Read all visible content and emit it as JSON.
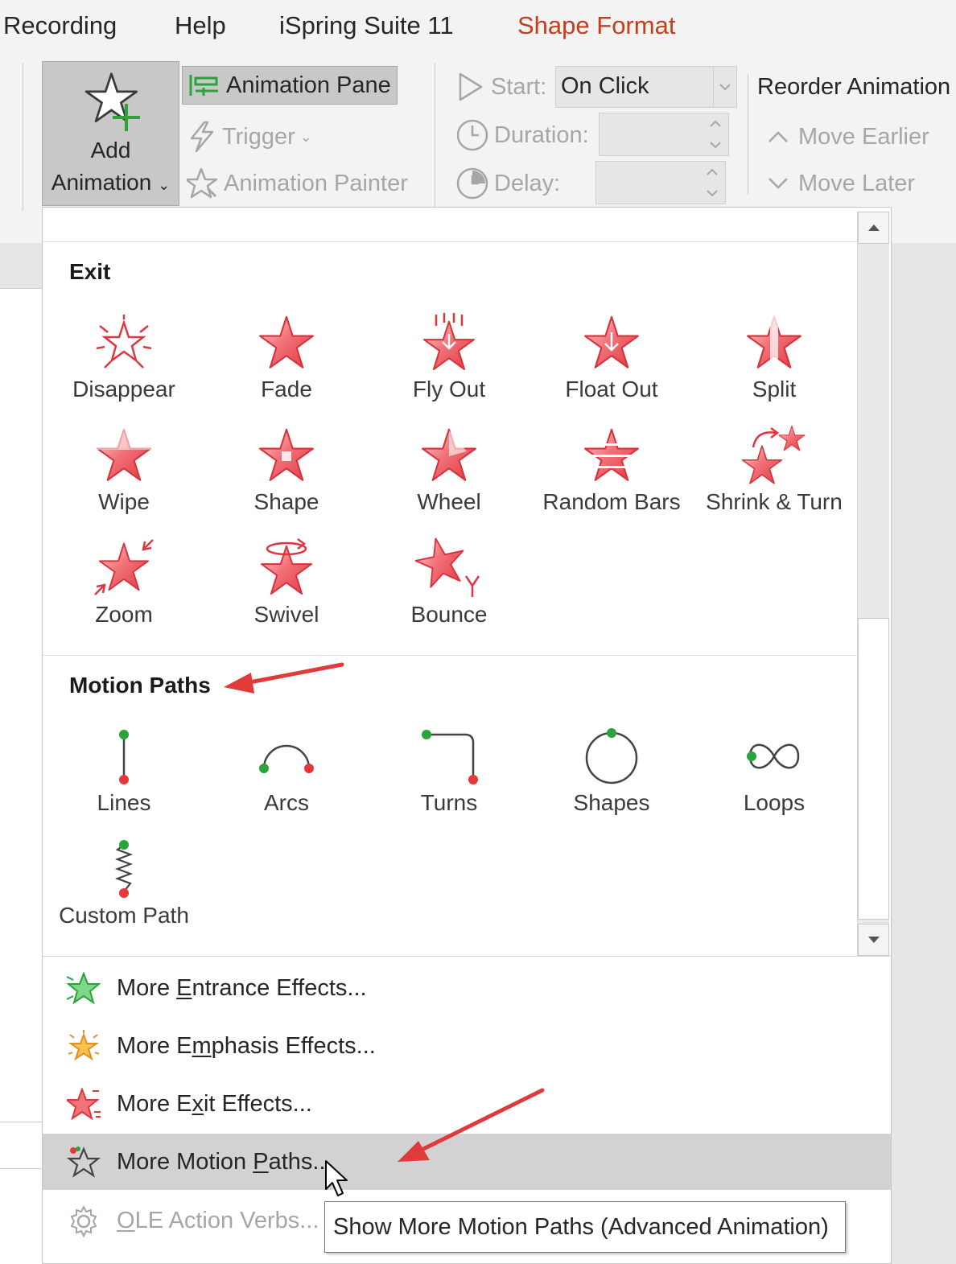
{
  "tabs": [
    "Recording",
    "Help",
    "iSpring Suite 11",
    "Shape Format"
  ],
  "ribbon": {
    "add_animation": {
      "line1": "Add",
      "line2": "Animation"
    },
    "animation_pane": "Animation Pane",
    "trigger": "Trigger",
    "animation_painter": "Animation Painter",
    "start_label": "Start:",
    "start_value": "On Click",
    "duration_label": "Duration:",
    "delay_label": "Delay:",
    "reorder_title": "Reorder Animation",
    "move_earlier": "Move Earlier",
    "move_later": "Move Later"
  },
  "gallery": {
    "exit": {
      "title": "Exit",
      "items": [
        "Disappear",
        "Fade",
        "Fly Out",
        "Float Out",
        "Split",
        "Wipe",
        "Shape",
        "Wheel",
        "Random Bars",
        "Shrink & Turn",
        "Zoom",
        "Swivel",
        "Bounce"
      ]
    },
    "motion": {
      "title": "Motion Paths",
      "items": [
        "Lines",
        "Arcs",
        "Turns",
        "Shapes",
        "Loops",
        "Custom Path"
      ]
    }
  },
  "menu": {
    "entrance": {
      "pre": "More ",
      "key": "E",
      "post": "ntrance Effects..."
    },
    "emphasis": {
      "pre": "More E",
      "key": "m",
      "post": "phasis Effects..."
    },
    "exit": {
      "pre": "More E",
      "key": "x",
      "post": "it Effects..."
    },
    "motion": {
      "pre": "More Motion ",
      "key": "P",
      "post": "aths..."
    },
    "ole": {
      "pre": "",
      "key": "O",
      "post": "LE Action Verbs..."
    }
  },
  "tooltip": "Show More Motion Paths (Advanced Animation)",
  "colors": {
    "accent_tab": "#c43e1c",
    "star_red": "#e84a52",
    "path_green": "#2aa33a",
    "path_red": "#e5383b",
    "annotation_arrow": "#e03a3a"
  }
}
